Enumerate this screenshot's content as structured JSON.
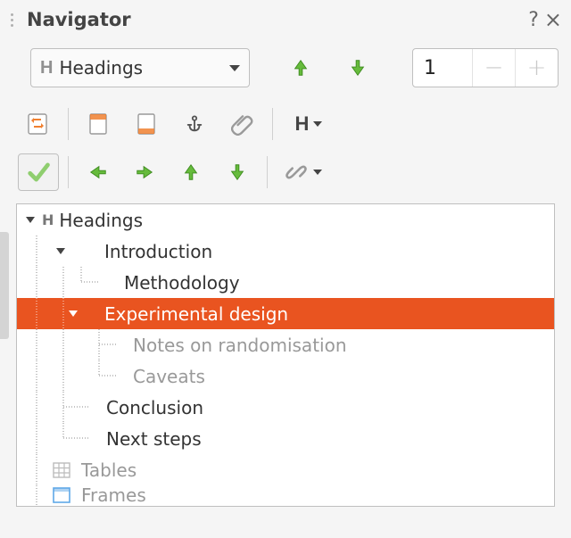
{
  "window": {
    "title": "Navigator",
    "help": "?",
    "close": "×"
  },
  "row1": {
    "dropdown_label": "Headings",
    "spin_value": "1"
  },
  "tree": {
    "root": "Headings",
    "intro": "Introduction",
    "methodology": "Methodology",
    "expdesign": "Experimental design",
    "notes": "Notes on randomisation",
    "caveats": "Caveats",
    "conclusion": "Conclusion",
    "nextsteps": "Next steps",
    "tables": "Tables",
    "frames": "Frames"
  },
  "colors": {
    "accent": "#e95420",
    "green": "#66bb3c",
    "orange": "#f08030"
  }
}
